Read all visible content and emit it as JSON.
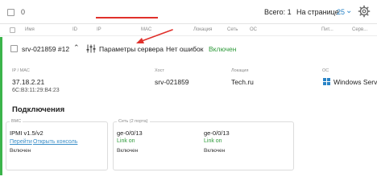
{
  "topbar": {
    "selected_count": "0",
    "total": "Всего: 1",
    "per_page_label": "На странице:",
    "per_page_value": "25"
  },
  "columns": [
    "Имя",
    "ID",
    "IP",
    "MAC",
    "Локация",
    "Сеть",
    "ОС",
    "Пит...",
    "Серв..."
  ],
  "server": {
    "name": "srv-021859 #12",
    "params_link": "Параметры сервера",
    "errors": "Нет ошибок",
    "status": "Включен",
    "status_color": "#2e9a3a",
    "ip_mac_label": "IP / MAC",
    "ip": "37.18.2.21",
    "mac": "6C:B3:11:29:B4:23",
    "host_label": "Хост",
    "host": "srv-021859",
    "location_label": "Локация",
    "location": "Tech.ru",
    "os_label": "ОС",
    "os": "Windows Server"
  },
  "connections": {
    "title": "Подключения",
    "bmc": {
      "title": "BMC",
      "name": "IPMI v1.5/v2",
      "goto": "Перейти",
      "console": "Открыть консоль",
      "status": "Включен"
    },
    "network": {
      "title": "Сеть (2 порта)",
      "ports": [
        {
          "name": "ge-0/0/13",
          "link": "Link on",
          "status": "Включен"
        },
        {
          "name": "ge-0/0/13",
          "link": "Link on",
          "status": "Включен"
        }
      ]
    }
  },
  "colors": {
    "accent_green": "#3cb44b",
    "link_blue": "#3a8ec8",
    "annotation_red": "#e0302b"
  },
  "icons": [
    "chevron-down-icon",
    "gear-icon",
    "sliders-icon",
    "windows-icon",
    "arrow-annotation"
  ]
}
